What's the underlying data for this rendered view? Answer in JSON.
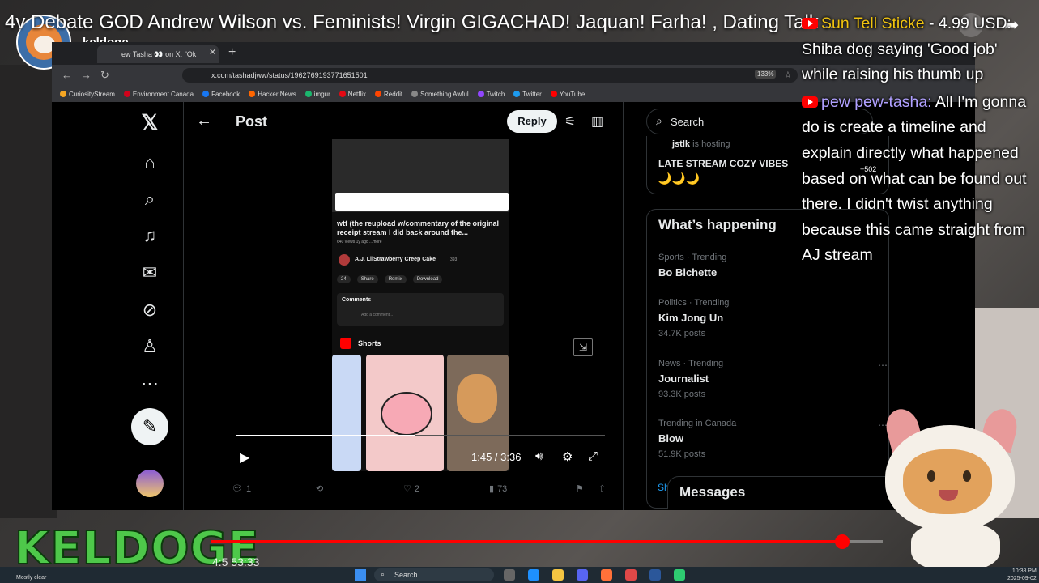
{
  "youtube": {
    "title": "4v Debate GOD Andrew Wilson vs. Feminists! Virgin GIGACHAD! Jaquan! Farha! , Dating Talk ...",
    "channel": "keldoge",
    "elapsed_time": "4:5 53:33",
    "branding": "KELDOGE",
    "progress_fraction": 0.94
  },
  "browser": {
    "tab_title": "ew Tasha 👀 on X: \"Ok",
    "url": "x.com/tashadjww/status/1962769193771651501",
    "zoom": "133%",
    "bookmarks": [
      {
        "label": "CuriosityStream",
        "color": "#f5a623"
      },
      {
        "label": "Environment Canada",
        "color": "#d0021b"
      },
      {
        "label": "Facebook",
        "color": "#1877f2"
      },
      {
        "label": "Hacker News",
        "color": "#ff6600"
      },
      {
        "label": "imgur",
        "color": "#1bb76e"
      },
      {
        "label": "Netflix",
        "color": "#e50914"
      },
      {
        "label": "Reddit",
        "color": "#ff4500"
      },
      {
        "label": "Something Awful",
        "color": "#888888"
      },
      {
        "label": "Twitch",
        "color": "#9146ff"
      },
      {
        "label": "Twitter",
        "color": "#1d9bf0"
      },
      {
        "label": "YouTube",
        "color": "#ff0000"
      }
    ]
  },
  "x": {
    "post_header": "Post",
    "reply_label": "Reply",
    "search_placeholder": "Search",
    "live": {
      "host_name": "jstlk",
      "host_suffix": "is hosting",
      "title": "LATE STREAM COZY VIBES",
      "emoji": "🌙🌙🌙",
      "listeners": "+502"
    },
    "trends_title": "What’s happening",
    "trends": [
      {
        "category": "Sports · Trending",
        "name": "Bo Bichette",
        "posts": ""
      },
      {
        "category": "Politics · Trending",
        "name": "Kim Jong Un",
        "posts": "34.7K posts"
      },
      {
        "category": "News · Trending",
        "name": "Journalist",
        "posts": "93.3K posts"
      },
      {
        "category": "Trending in Canada",
        "name": "Blow",
        "posts": "51.9K posts"
      }
    ],
    "show_more": "Sh",
    "messages_label": "Messages",
    "engagement": {
      "replies": "1",
      "reposts": "",
      "likes": "2",
      "views": "73"
    }
  },
  "video": {
    "title": "wtf (the reupload w/commentary of the original receipt stream I did back around the...",
    "meta": "640 views  1y ago  ...more",
    "channel": "A.J. LilStrawberry Creep Cake",
    "subs": "393",
    "actions": [
      "24",
      "Share",
      "Remix",
      "Download"
    ],
    "comments_title": "Comments",
    "comment_placeholder": "Add a comment...",
    "shorts_label": "Shorts",
    "time": "1:45 / 3:36"
  },
  "chat": [
    {
      "name": "Sun Tell Sticke",
      "amount": "4.99 USD:",
      "text": "Shiba dog saying 'Good job' while raising his thumb up"
    },
    {
      "name": "pew pew-tasha:",
      "text": "All I'm gonna do is create a timeline and explain directly what happened based on what can be found out there. I didn't twist anything because this came straight from AJ stream"
    }
  ],
  "taskbar": {
    "weather": "Mostly clear",
    "search": "Search",
    "time": "10:38 PM",
    "date": "2025-09-02"
  }
}
